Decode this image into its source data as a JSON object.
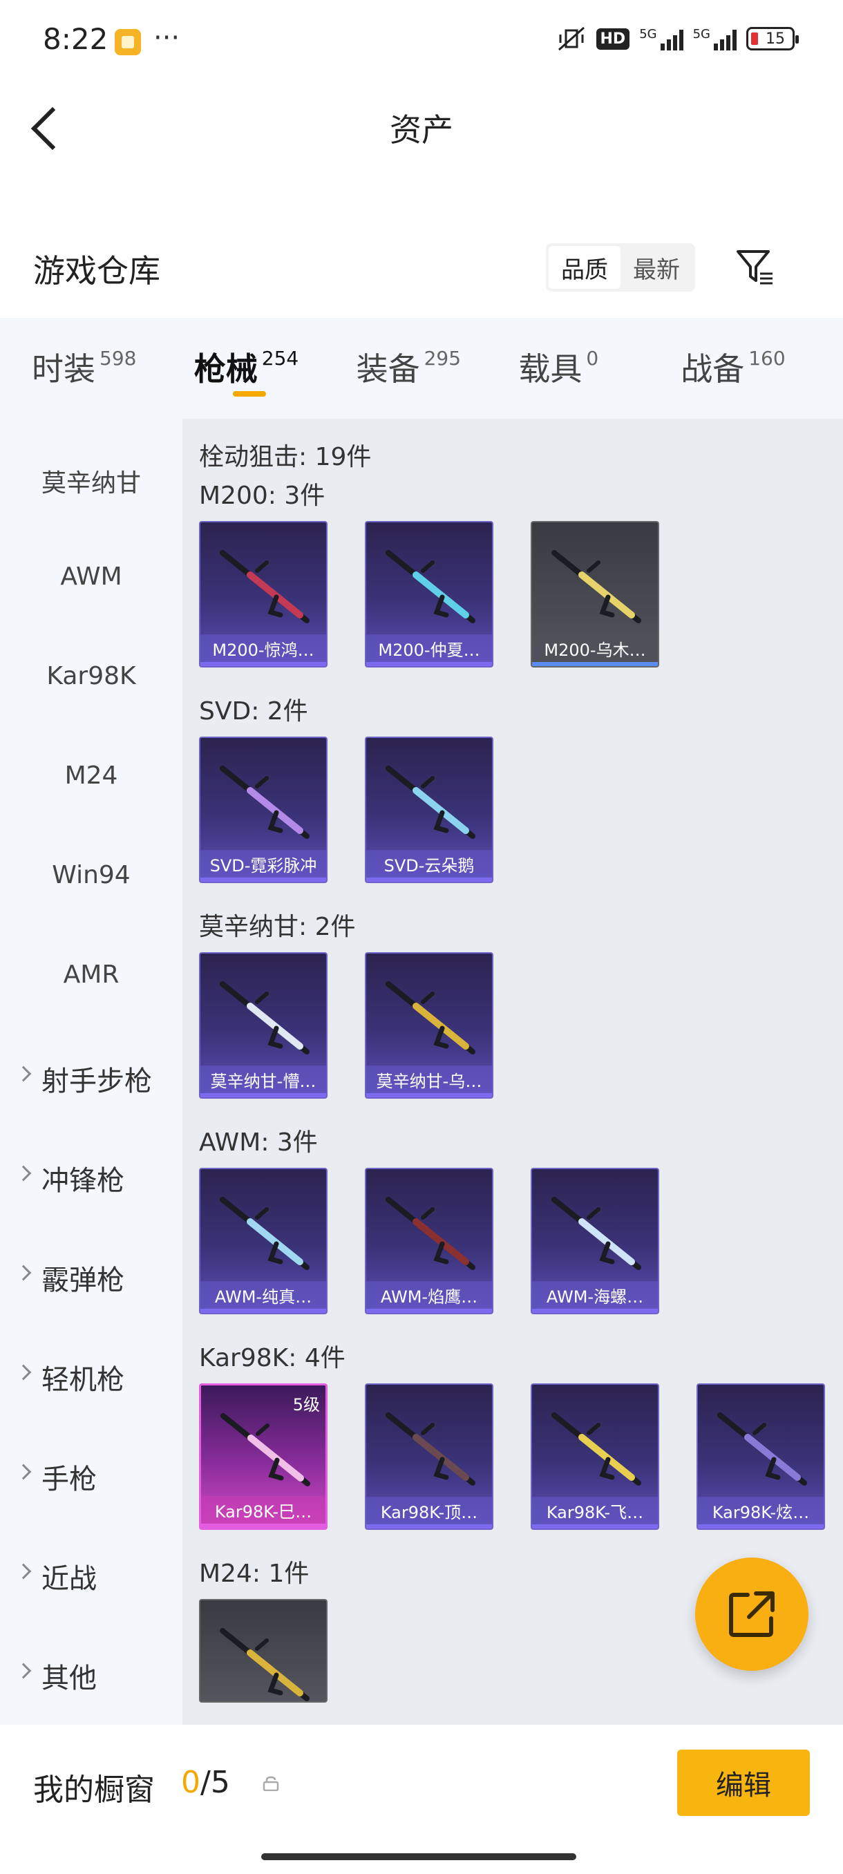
{
  "status_bar": {
    "time": "8:22",
    "more": "···",
    "hd": "HD",
    "signal1": "5G",
    "signal2": "5G",
    "battery": "15"
  },
  "header": {
    "title": "资产"
  },
  "warehouse": {
    "title": "游戏仓库",
    "sort_options": [
      "品质",
      "最新"
    ],
    "sort_active": "品质"
  },
  "tabs": [
    {
      "name": "时装",
      "count": "598"
    },
    {
      "name": "枪械",
      "count": "254"
    },
    {
      "name": "装备",
      "count": "295"
    },
    {
      "name": "载具",
      "count": "0"
    },
    {
      "name": "战备",
      "count": "160"
    }
  ],
  "sidebar": {
    "items": [
      "莫辛纳甘",
      "AWM",
      "Kar98K",
      "M24",
      "Win94",
      "AMR"
    ],
    "groups": [
      "射手步枪",
      "冲锋枪",
      "霰弹枪",
      "轻机枪",
      "手枪",
      "近战",
      "其他"
    ]
  },
  "content": {
    "category_title": "栓动狙击: 19件",
    "sections": [
      {
        "title": "M200: 3件",
        "items": [
          {
            "name": "M200-惊鸿…",
            "style": "purple"
          },
          {
            "name": "M200-仲夏…",
            "style": "purple"
          },
          {
            "name": "M200-乌木…",
            "style": "gray"
          }
        ]
      },
      {
        "title": "SVD: 2件",
        "items": [
          {
            "name": "SVD-霓彩脉冲",
            "style": "purple"
          },
          {
            "name": "SVD-云朵鹅",
            "style": "purple"
          }
        ]
      },
      {
        "title": "莫辛纳甘: 2件",
        "items": [
          {
            "name": "莫辛纳甘-懵…",
            "style": "purple"
          },
          {
            "name": "莫辛纳甘-乌…",
            "style": "purple"
          }
        ]
      },
      {
        "title": "AWM: 3件",
        "items": [
          {
            "name": "AWM-纯真…",
            "style": "purple"
          },
          {
            "name": "AWM-焰鹰…",
            "style": "purple"
          },
          {
            "name": "AWM-海螺…",
            "style": "purple"
          }
        ]
      },
      {
        "title": "Kar98K: 4件",
        "items": [
          {
            "name": "Kar98K-巳…",
            "style": "pink",
            "level": "5级"
          },
          {
            "name": "Kar98K-顶…",
            "style": "purple"
          },
          {
            "name": "Kar98K-飞…",
            "style": "purple"
          },
          {
            "name": "Kar98K-炫…",
            "style": "purple"
          }
        ]
      },
      {
        "title": "M24: 1件",
        "items": [
          {
            "name": "",
            "style": "gray"
          }
        ]
      }
    ]
  },
  "showcase": {
    "label": "我的橱窗",
    "current": "0",
    "total": "/5",
    "edit": "编辑"
  },
  "colors": {
    "accent": "#f9b50f",
    "sidebar_bg": "#f4f7fb",
    "content_bg": "#e9ecf1"
  }
}
